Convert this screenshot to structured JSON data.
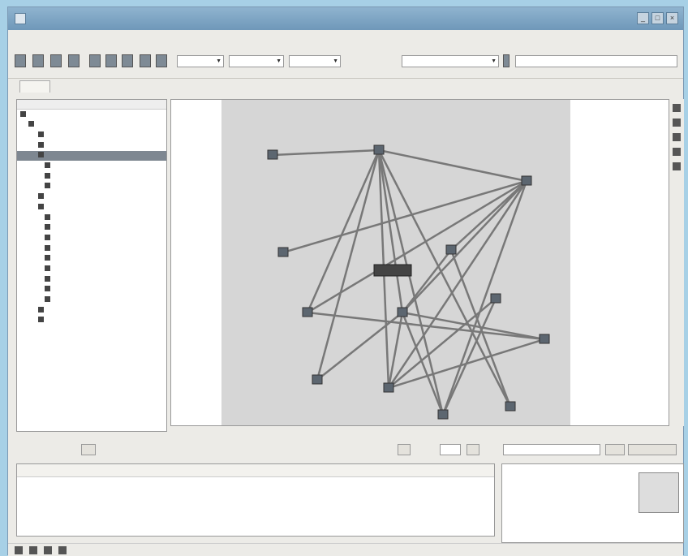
{
  "window": {
    "title": ""
  },
  "menu": {
    "items": [
      "",
      "",
      "",
      "",
      "",
      "",
      "",
      ""
    ]
  },
  "toolbar": {
    "combo1": "",
    "combo2": "",
    "combo3": "",
    "search_value": "",
    "search2_value": ""
  },
  "tabs": {
    "active": ""
  },
  "tree": {
    "columns": [
      "",
      ""
    ],
    "rows": [
      {
        "label": "",
        "ip": ""
      },
      {
        "label": "",
        "ip": ""
      },
      {
        "label": "",
        "ip": ""
      },
      {
        "label": "",
        "ip": ""
      },
      {
        "label": "",
        "ip": ""
      },
      {
        "label": "",
        "ip": ""
      },
      {
        "label": "",
        "ip": ""
      },
      {
        "label": "",
        "ip": ""
      },
      {
        "label": "",
        "ip": ""
      },
      {
        "label": "",
        "ip": ""
      },
      {
        "label": "",
        "ip": ""
      },
      {
        "label": "",
        "ip": ""
      },
      {
        "label": "",
        "ip": ""
      },
      {
        "label": "",
        "ip": ""
      },
      {
        "label": "",
        "ip": ""
      },
      {
        "label": "",
        "ip": ""
      },
      {
        "label": "",
        "ip": ""
      },
      {
        "label": "",
        "ip": ""
      },
      {
        "label": "",
        "ip": ""
      },
      {
        "label": "",
        "ip": ""
      },
      {
        "label": "",
        "ip": ""
      }
    ]
  },
  "graph": {
    "center_node_label": "",
    "nodes": [
      {
        "label": ""
      },
      {
        "label": ""
      },
      {
        "label": ""
      },
      {
        "label": ""
      },
      {
        "label": ""
      },
      {
        "label": ""
      },
      {
        "label": ""
      },
      {
        "label": ""
      },
      {
        "label": ""
      },
      {
        "label": ""
      },
      {
        "label": ""
      },
      {
        "label": ""
      },
      {
        "label": ""
      }
    ]
  },
  "events_toolbar": {
    "left_label": "",
    "filter_text": "",
    "page_label": "",
    "details_label": ""
  },
  "events": {
    "columns": [
      "",
      "",
      "",
      "",
      ""
    ],
    "rows": [
      {
        "severity": "",
        "date": "",
        "time": "",
        "type": "",
        "message": ""
      },
      {
        "severity": "",
        "date": "",
        "time": "",
        "type": "",
        "message": ""
      },
      {
        "severity": "",
        "date": "",
        "time": "",
        "type": "",
        "message": ""
      },
      {
        "severity": "",
        "date": "",
        "time": "",
        "type": "",
        "message": ""
      },
      {
        "severity": "",
        "date": "",
        "time": "",
        "type": "",
        "message": ""
      }
    ]
  },
  "details": {
    "rows": [
      {
        "label": "",
        "value": ""
      },
      {
        "label": "",
        "value": ""
      },
      {
        "label": "",
        "value": ""
      },
      {
        "label": "",
        "value": ""
      },
      {
        "label": "",
        "value": ""
      }
    ]
  },
  "status": {
    "items": [
      "",
      "",
      ""
    ]
  },
  "colors": {
    "accent": "#6f98b9",
    "selection": "#7e8791",
    "canvas_bg": "#d6d6d6",
    "edge": "#787878"
  }
}
